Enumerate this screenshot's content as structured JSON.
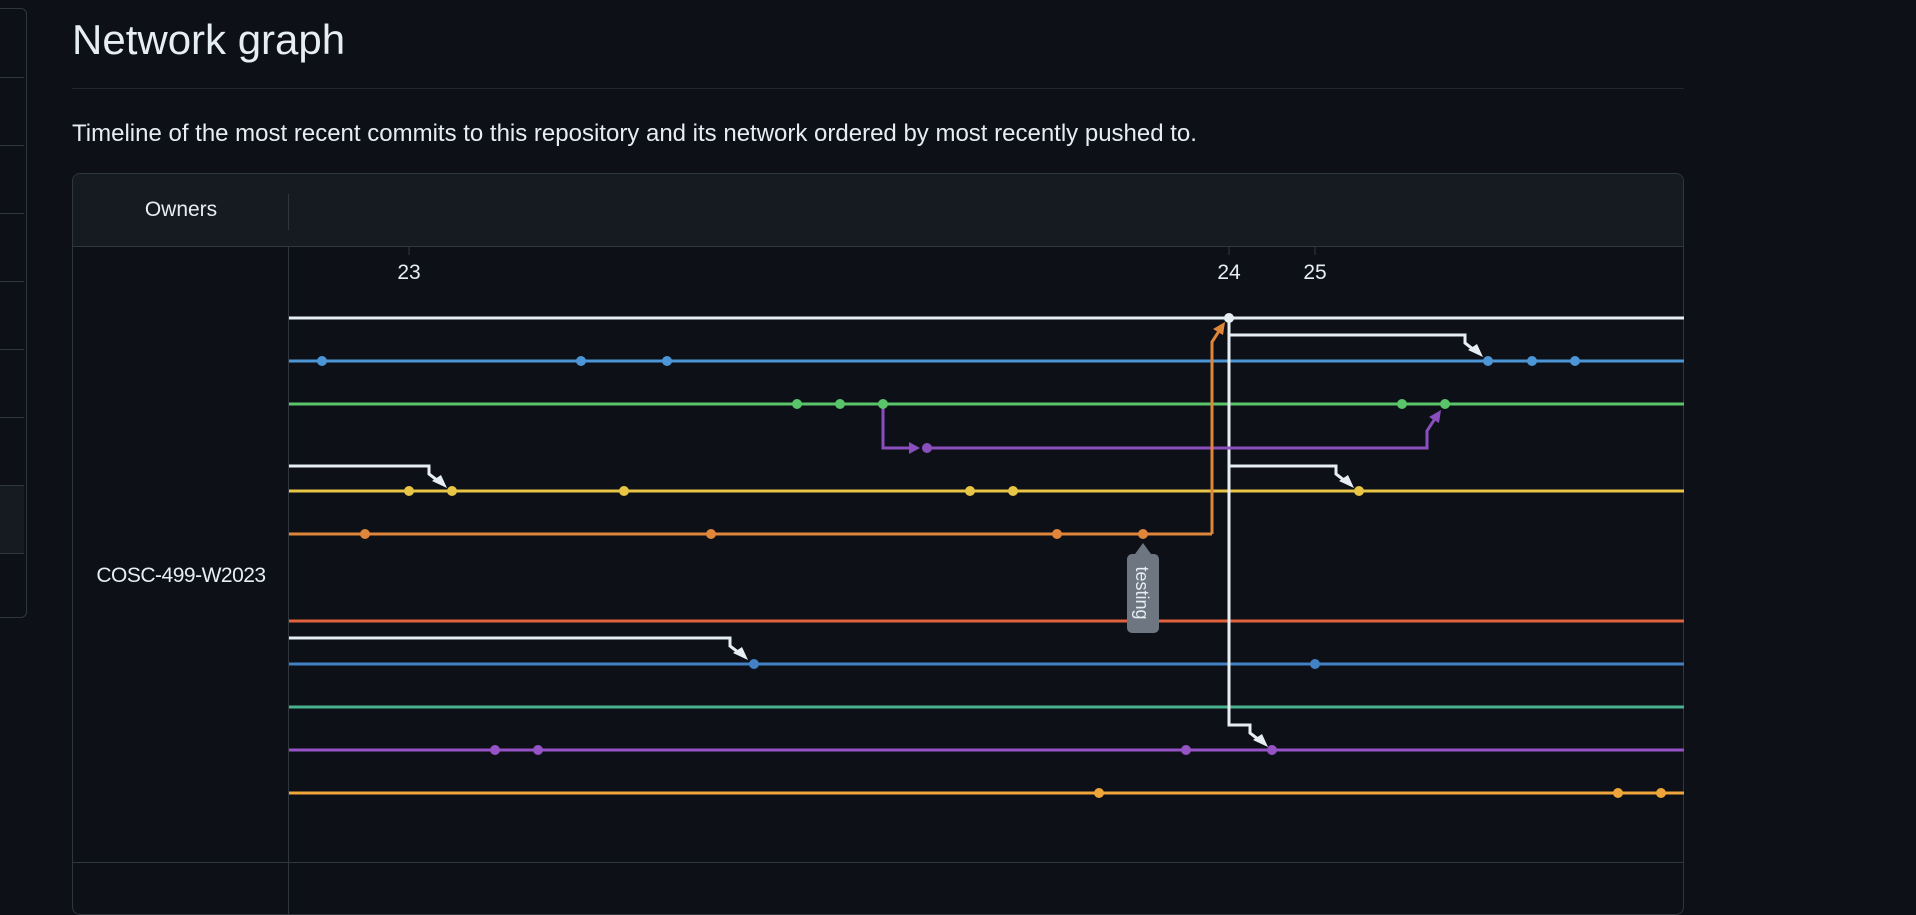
{
  "page": {
    "title": "Network graph",
    "description": "Timeline of the most recent commits to this repository and its network ordered by most recently pushed to."
  },
  "graph": {
    "owners_header": "Owners",
    "owner_name": "COSC-499-W2023",
    "date_labels": [
      "23",
      "24",
      "25"
    ],
    "branch_tag": "testing",
    "colors": {
      "white": "#e6edf3",
      "blue": "#4c96d7",
      "green": "#5ac46a",
      "purple": "#8a4ebf",
      "yellow": "#e8c544",
      "orange": "#e0863a",
      "red": "#e2613e",
      "steel": "#4181c4",
      "teal": "#48b18e",
      "violet": "#9553c6",
      "amber": "#efa539",
      "tag_bg": "#6e7681"
    }
  }
}
